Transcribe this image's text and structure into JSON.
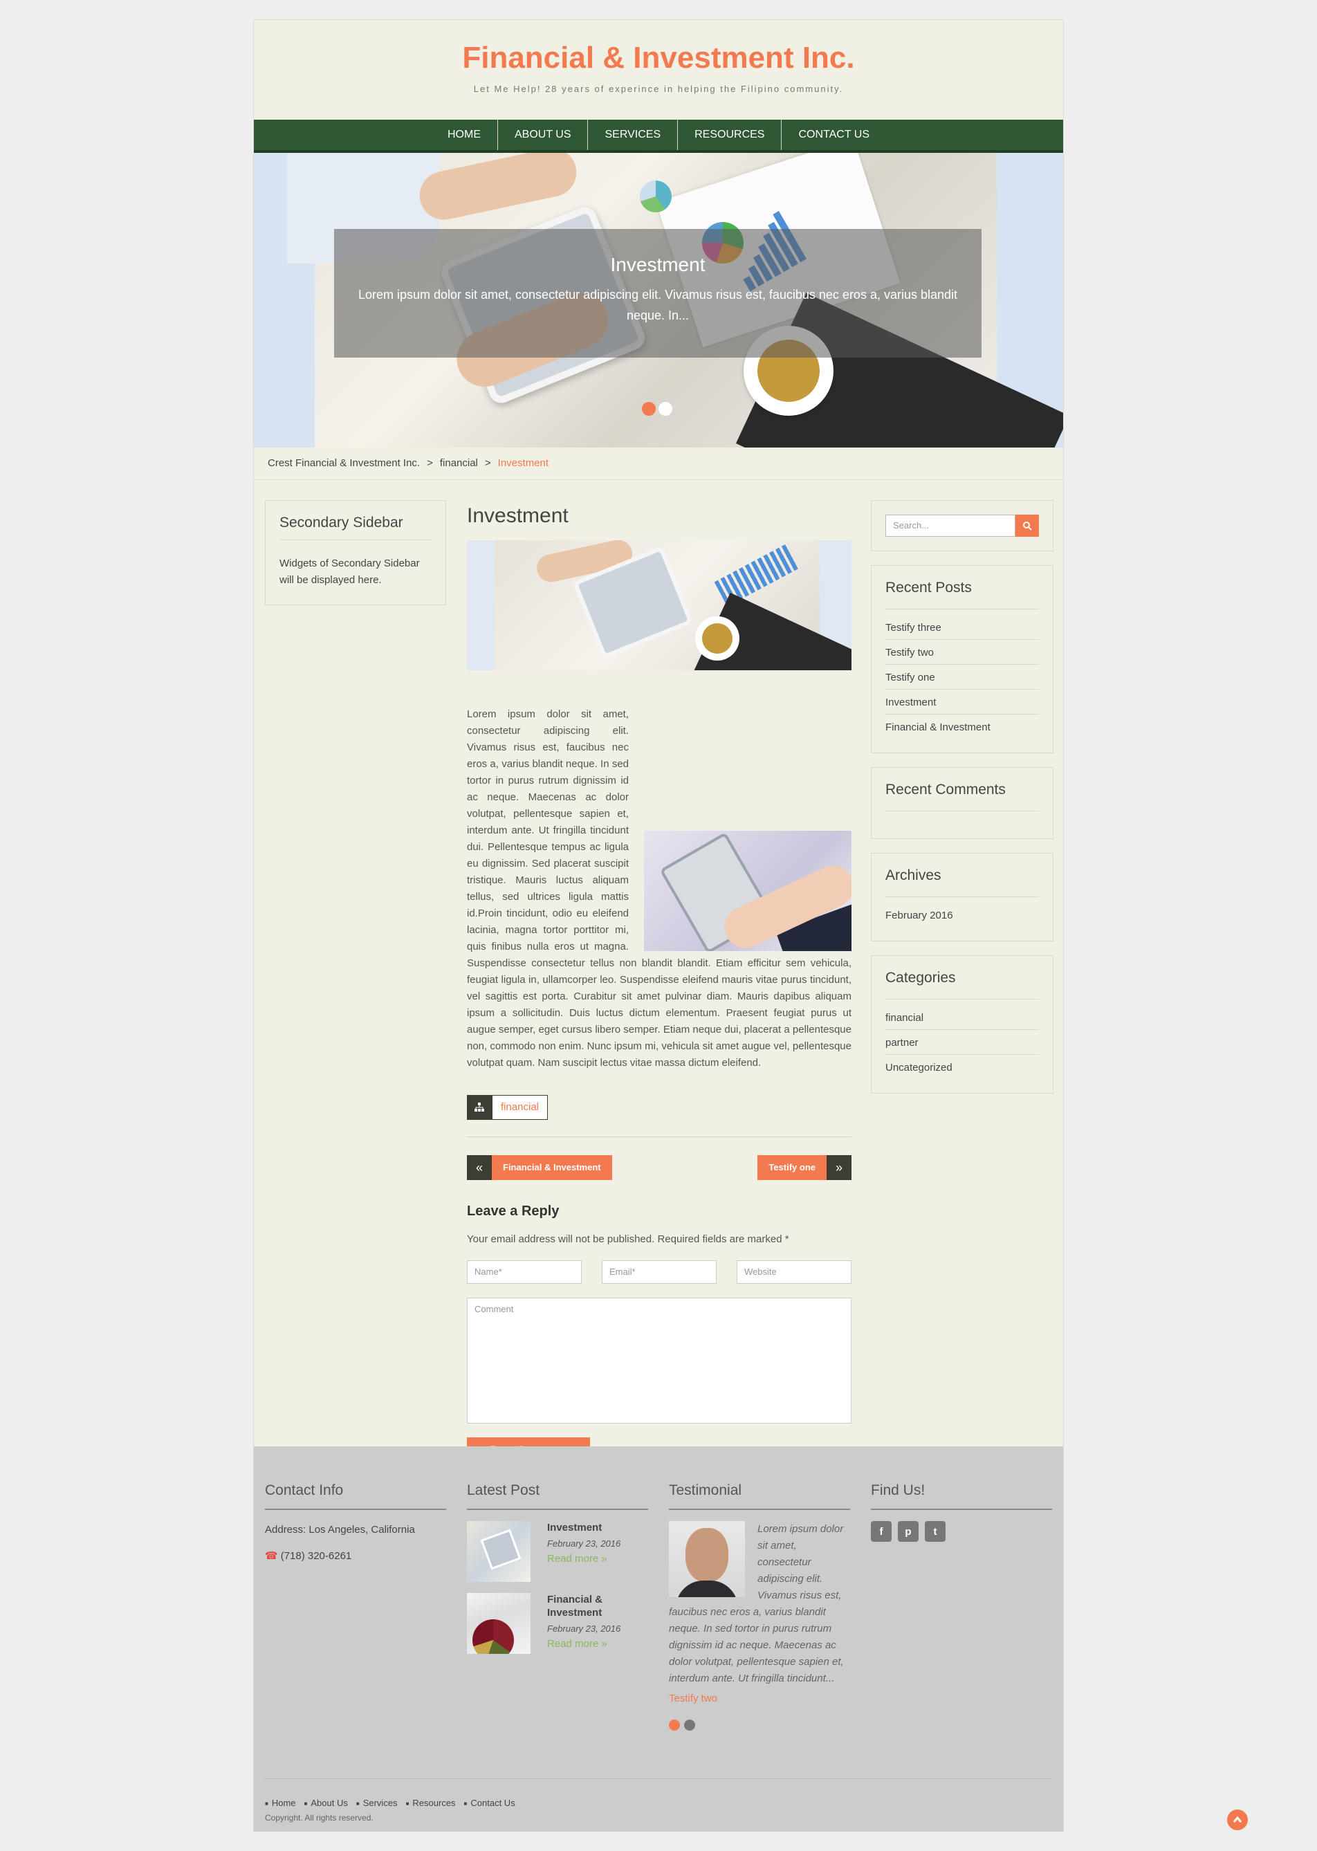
{
  "header": {
    "title": "Financial & Investment Inc.",
    "tagline": "Let Me Help! 28 years of experince in helping the Filipino community."
  },
  "nav": {
    "items": [
      "HOME",
      "ABOUT US",
      "SERVICES",
      "RESOURCES",
      "CONTACT US"
    ]
  },
  "slider": {
    "title": "Investment",
    "text": "Lorem ipsum dolor sit amet, consectetur adipiscing elit. Vivamus risus est, faucibus nec eros a, varius blandit neque. In..."
  },
  "breadcrumb": {
    "items": [
      "Crest Financial & Investment Inc.",
      "financial"
    ],
    "separator": ">",
    "current": "Investment"
  },
  "left_sidebar": {
    "title": "Secondary Sidebar",
    "text": "Widgets of Secondary Sidebar will be displayed here."
  },
  "post": {
    "title": "Investment",
    "body_part1": "Lorem ipsum dolor sit amet, consectetur adipiscing elit. Vivamus risus est, faucibus nec eros a, varius blandit neque. In sed tortor in purus rutrum dignissim id ac neque. Maecenas ac dolor volutpat, pellentesque sapien et, interdum ante. Ut fringilla tincidunt dui. Pellentesque tempus ac ligula eu dignissim. Sed placerat suscipit tristique. Mauris luctus aliquam tellus, sed ultrices ligula mattis id.Proin tincidunt, odio eu eleifend lacinia, magna tortor porttitor mi, quis finibus nulla eros ut magna. Suspendisse consectetur tellus non blandit blandit. Etiam efficitur sem vehicula, feugiat ligula in, ullamcorper leo. Suspendisse eleifend mauris vitae purus tincidunt, vel sagittis est porta. Curabitur sit amet pulvinar diam. Mauris dapibus aliquam ipsum a sollicitudin. Duis luctus dictum elementum. Praesent feugiat purus ut augue semper, eget cursus libero semper. Etiam neque dui, placerat a pellentesque non, commodo non enim. Nunc ipsum mi, vehicula sit amet augue vel, pellentesque volutpat quam. Nam suscipit lectus vitae massa dictum eleifend.",
    "tag": "financial",
    "prev_label": "Financial & Investment",
    "next_label": "Testify one"
  },
  "reply": {
    "title": "Leave a Reply",
    "note": "Your email address will not be published. Required fields are marked *",
    "name_placeholder": "Name*",
    "email_placeholder": "Email*",
    "website_placeholder": "Website",
    "comment_placeholder": "Comment",
    "submit": "Post Comment"
  },
  "right_sidebar": {
    "search_placeholder": "Search...",
    "recent_posts_title": "Recent Posts",
    "recent_posts": [
      "Testify three",
      "Testify two",
      "Testify one",
      "Investment",
      "Financial & Investment"
    ],
    "recent_comments_title": "Recent Comments",
    "archives_title": "Archives",
    "archives": [
      "February 2016"
    ],
    "categories_title": "Categories",
    "categories": [
      "financial",
      "partner",
      "Uncategorized"
    ]
  },
  "footer": {
    "contact_title": "Contact Info",
    "address": "Address: Los Angeles, California",
    "phone": "(718) 320-6261",
    "latest_title": "Latest Post",
    "latest": [
      {
        "title": "Investment",
        "date": "February 23, 2016",
        "more": "Read more »"
      },
      {
        "title": "Financial & Investment",
        "date": "February 23, 2016",
        "more": "Read more »"
      }
    ],
    "testimonial_title": "Testimonial",
    "testimonial_text": "Lorem ipsum dolor sit amet, consectetur adipiscing elit. Vivamus risus est, faucibus nec eros a, varius blandit neque. In sed tortor in purus rutrum dignissim id ac neque. Maecenas ac dolor volutpat, pellentesque sapien et, interdum ante. Ut fringilla tincidunt...",
    "testimonial_name": "Testify two",
    "findus_title": "Find Us!",
    "social": [
      "f",
      "p",
      "t"
    ],
    "menu": [
      "Home",
      "About Us",
      "Services",
      "Resources",
      "Contact Us"
    ],
    "copyright": "Copyright. All rights reserved."
  },
  "colors": {
    "accent": "#f27a4e",
    "nav_bg": "#2f5733",
    "page_bg": "#f0f0e5",
    "footer_bg": "#cccccc"
  },
  "icons": {
    "tag": "sitemap-icon",
    "search": "search-icon",
    "phone": "phone-icon",
    "scroll_top": "chevron-up-icon"
  }
}
